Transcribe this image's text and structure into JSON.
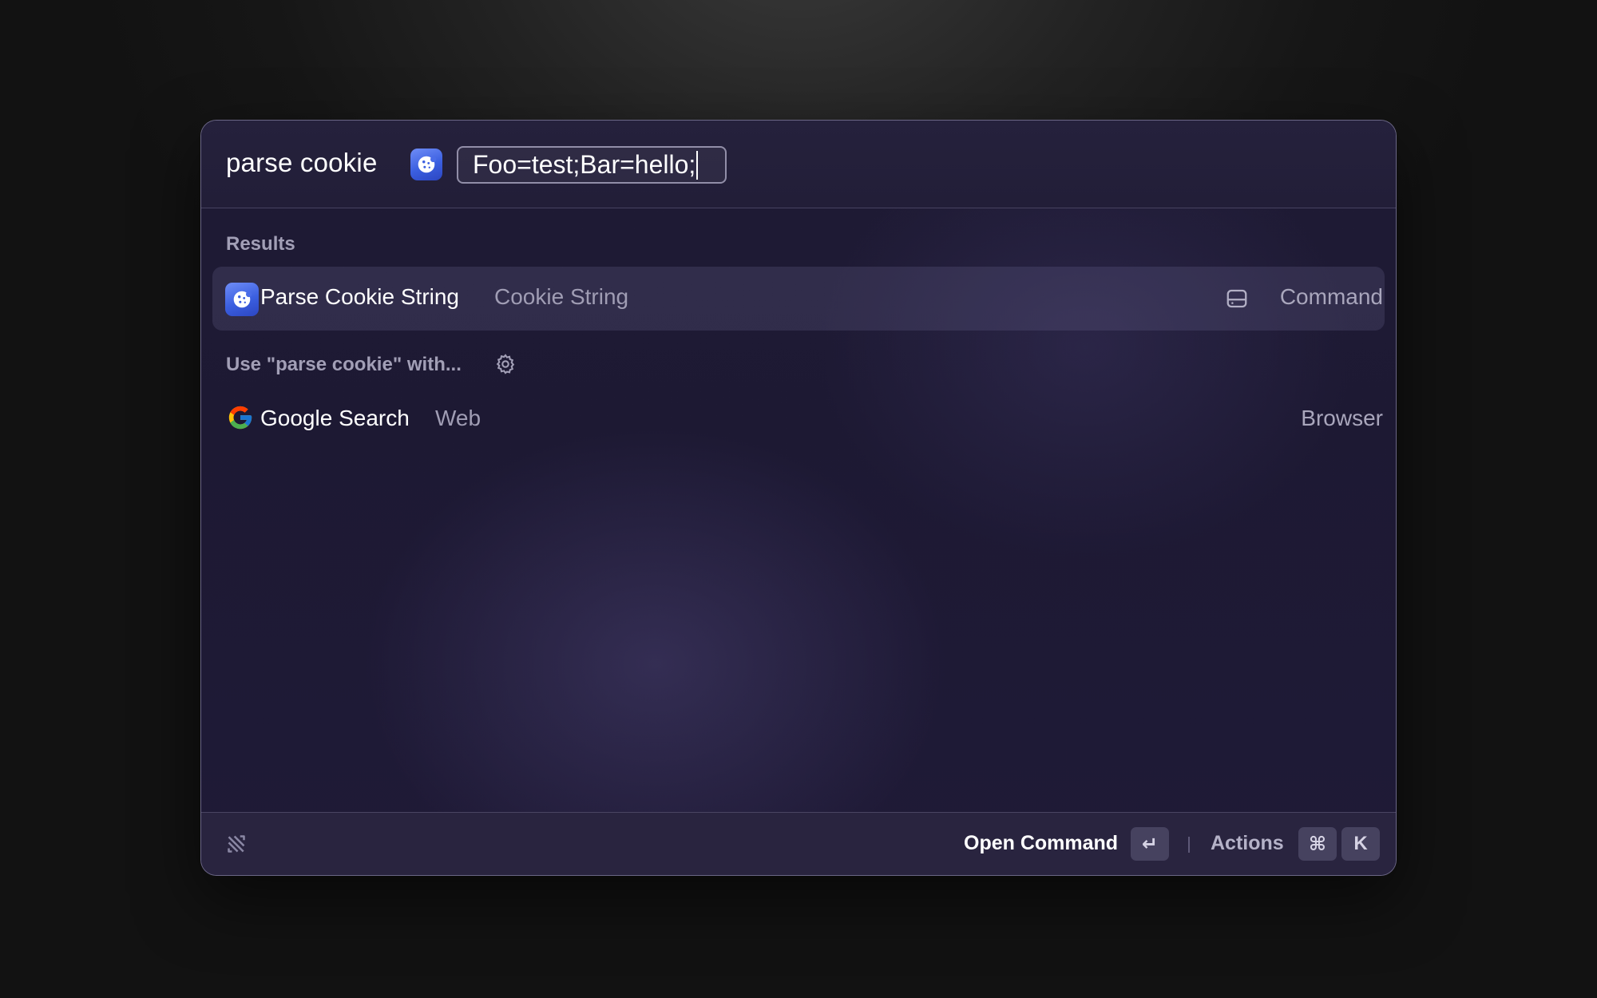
{
  "search": {
    "query": "parse cookie",
    "argument_value": "Foo=test;Bar=hello;"
  },
  "sections": {
    "results_label": "Results",
    "fallback_label": "Use \"parse cookie\" with..."
  },
  "results": [
    {
      "title": "Parse Cookie String",
      "subtitle": "Cookie String",
      "accessory": "Command",
      "icon": "cookie-icon",
      "accessory_icon": "drive-icon",
      "selected": true
    }
  ],
  "fallbacks": [
    {
      "title": "Google Search",
      "subtitle": "Web",
      "accessory": "Browser",
      "icon": "google-icon"
    }
  ],
  "footer": {
    "primary_action": "Open Command",
    "primary_shortcut": "↵",
    "secondary_action": "Actions",
    "secondary_shortcut_mod": "⌘",
    "secondary_shortcut_key": "K"
  },
  "colors": {
    "window_background": "#1f1b35",
    "selected_row": "#3a3550",
    "cookie_icon_blue": "#3b5fe0",
    "secondary_text": "#a09db4"
  }
}
